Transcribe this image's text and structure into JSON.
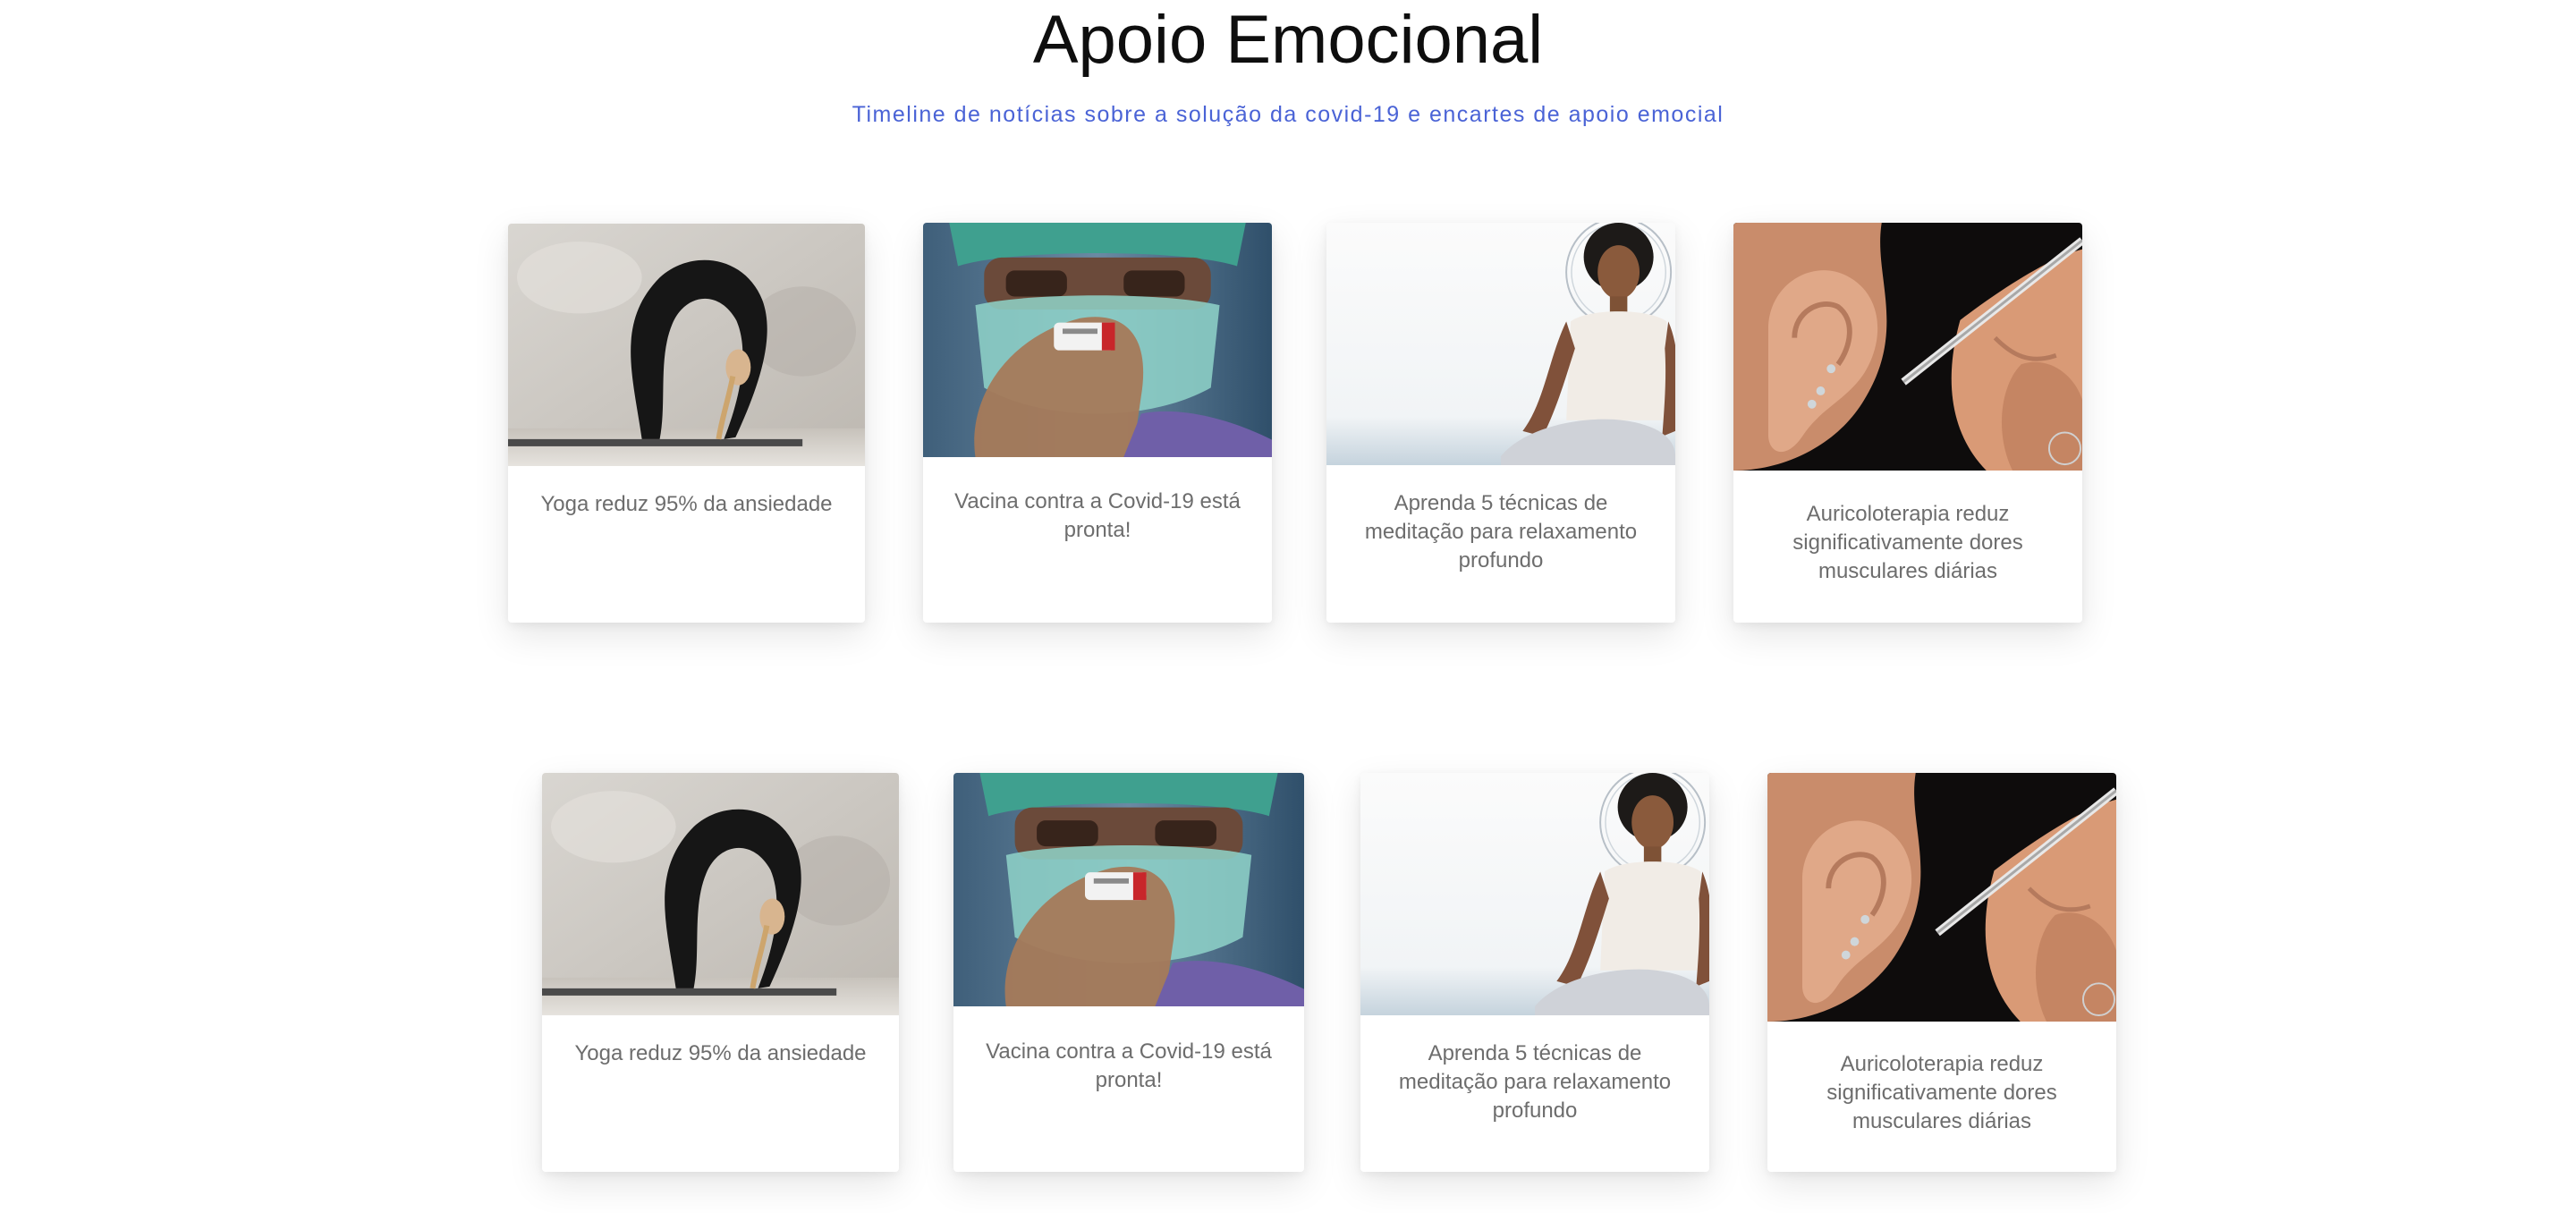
{
  "header": {
    "title": "Apoio Emocional",
    "subtitle": "Timeline de notícias sobre a solução da covid-19 e encartes de apoio emocial"
  },
  "cards": [
    {
      "caption": "Yoga reduz 95% da ansiedade",
      "image": "yoga-pose-image"
    },
    {
      "caption": "Vacina contra a Covid-19 está pronta!",
      "image": "vaccine-vial-image"
    },
    {
      "caption": "Aprenda 5 técnicas de meditação para relaxamento profundo",
      "image": "meditation-woman-image"
    },
    {
      "caption": "Auricoloterapia reduz significativamente dores musculares diárias",
      "image": "ear-acupuncture-image"
    },
    {
      "caption": "Yoga reduz 95% da ansiedade",
      "image": "yoga-pose-image"
    },
    {
      "caption": "Vacina contra a Covid-19 está pronta!",
      "image": "vaccine-vial-image"
    },
    {
      "caption": "Aprenda 5 técnicas de meditação para relaxamento profundo",
      "image": "meditation-woman-image"
    },
    {
      "caption": "Auricoloterapia reduz significativamente dores musculares diárias",
      "image": "ear-acupuncture-image"
    }
  ],
  "colors": {
    "subtitle": "#4a63d6",
    "title": "#0e0e0e",
    "caption": "#6d6d6d"
  }
}
